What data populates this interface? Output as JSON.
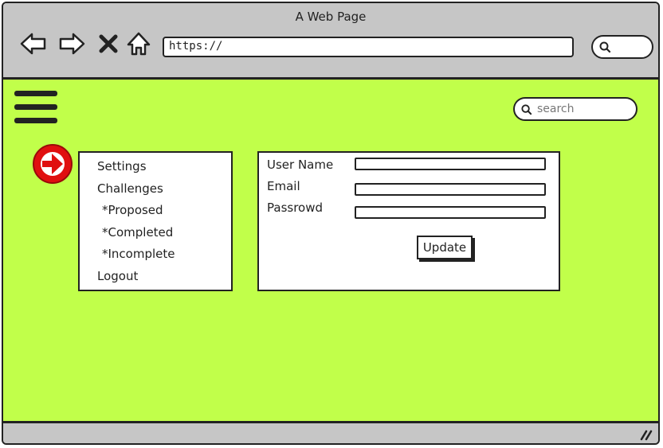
{
  "window": {
    "title": "A Web Page"
  },
  "toolbar": {
    "icons": [
      "back-arrow-icon",
      "forward-arrow-icon",
      "close-icon",
      "home-icon"
    ],
    "url": "https://",
    "search_icon": "search-icon"
  },
  "page": {
    "background_color": "#c1ff4a",
    "search": {
      "placeholder": "search"
    },
    "menu": {
      "items": [
        {
          "label": "Settings"
        },
        {
          "label": "Challenges"
        },
        {
          "label": "*Proposed"
        },
        {
          "label": "*Completed"
        },
        {
          "label": "*Incomplete"
        },
        {
          "label": "Logout"
        }
      ]
    },
    "form": {
      "fields": [
        {
          "label": "User Name",
          "value": ""
        },
        {
          "label": "Email",
          "value": ""
        },
        {
          "label": "Passrowd",
          "value": ""
        }
      ],
      "submit_label": "Update"
    },
    "arrow_icon_color": "#e01010"
  }
}
